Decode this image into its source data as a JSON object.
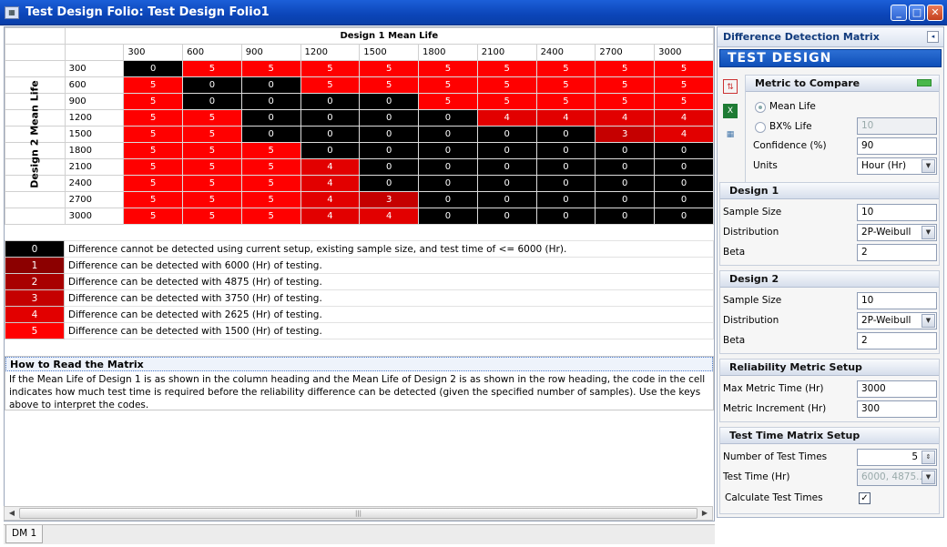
{
  "window": {
    "title": "Test Design Folio: Test Design Folio1",
    "app_icon": "app-icon",
    "buttons": {
      "minimize": "_",
      "maximize": "□",
      "close": "✕"
    }
  },
  "matrix": {
    "title": "Design 1 Mean Life",
    "y_label": "Design 2 Mean Life",
    "columns": [
      "300",
      "600",
      "900",
      "1200",
      "1500",
      "1800",
      "2100",
      "2400",
      "2700",
      "3000"
    ],
    "rows": [
      {
        "label": "300",
        "values": [
          "0",
          "5",
          "5",
          "5",
          "5",
          "5",
          "5",
          "5",
          "5",
          "5"
        ]
      },
      {
        "label": "600",
        "values": [
          "5",
          "0",
          "0",
          "5",
          "5",
          "5",
          "5",
          "5",
          "5",
          "5"
        ]
      },
      {
        "label": "900",
        "values": [
          "5",
          "0",
          "0",
          "0",
          "0",
          "5",
          "5",
          "5",
          "5",
          "5"
        ]
      },
      {
        "label": "1200",
        "values": [
          "5",
          "5",
          "0",
          "0",
          "0",
          "0",
          "4",
          "4",
          "4",
          "4"
        ]
      },
      {
        "label": "1500",
        "values": [
          "5",
          "5",
          "0",
          "0",
          "0",
          "0",
          "0",
          "0",
          "3",
          "4"
        ]
      },
      {
        "label": "1800",
        "values": [
          "5",
          "5",
          "5",
          "0",
          "0",
          "0",
          "0",
          "0",
          "0",
          "0"
        ]
      },
      {
        "label": "2100",
        "values": [
          "5",
          "5",
          "5",
          "4",
          "0",
          "0",
          "0",
          "0",
          "0",
          "0"
        ]
      },
      {
        "label": "2400",
        "values": [
          "5",
          "5",
          "5",
          "4",
          "0",
          "0",
          "0",
          "0",
          "0",
          "0"
        ]
      },
      {
        "label": "2700",
        "values": [
          "5",
          "5",
          "5",
          "4",
          "3",
          "0",
          "0",
          "0",
          "0",
          "0"
        ]
      },
      {
        "label": "3000",
        "values": [
          "5",
          "5",
          "5",
          "4",
          "4",
          "0",
          "0",
          "0",
          "0",
          "0"
        ]
      }
    ]
  },
  "code_colors": {
    "0": "#000000",
    "1": "#8c0000",
    "2": "#a80000",
    "3": "#c50000",
    "4": "#e20000",
    "5": "#ff0000"
  },
  "legend": [
    {
      "code": "0",
      "text": "Difference cannot be detected using current setup, existing sample size, and test time of <= 6000 (Hr)."
    },
    {
      "code": "1",
      "text": "Difference can be detected with 6000 (Hr) of testing."
    },
    {
      "code": "2",
      "text": "Difference can be detected with 4875 (Hr) of testing."
    },
    {
      "code": "3",
      "text": "Difference can be detected with 3750 (Hr) of testing."
    },
    {
      "code": "4",
      "text": "Difference can be detected with 2625 (Hr) of testing."
    },
    {
      "code": "5",
      "text": "Difference can be detected with 1500 (Hr) of testing."
    }
  ],
  "howto": {
    "title": "How to Read the Matrix",
    "body": "If the Mean Life of Design 1 is as shown in the column heading and the Mean Life of Design 2 is as shown in the row heading, the code in the cell indicates how much test time is required before the reliability difference can be detected (given the specified number of samples). Use the keys above to interpret the codes."
  },
  "scrollbar": {
    "left_arrow": "◀",
    "right_arrow": "▶",
    "grip": "|||"
  },
  "tabs": [
    "DM 1"
  ],
  "panel": {
    "title": "Difference Detection Matrix",
    "pin": "◂",
    "banner": "TEST DESIGN",
    "icons": [
      "transfer-icon",
      "excel-icon",
      "grid-icon"
    ],
    "metric": {
      "title": "Metric to Compare",
      "mean_life": "Mean Life",
      "bx_life": "BX% Life",
      "bx_value": "10",
      "confidence_label": "Confidence (%)",
      "confidence": "90",
      "units_label": "Units",
      "units": "Hour (Hr)"
    },
    "design1": {
      "title": "Design 1",
      "sample_size_label": "Sample Size",
      "sample_size": "10",
      "distribution_label": "Distribution",
      "distribution": "2P-Weibull",
      "beta_label": "Beta",
      "beta": "2"
    },
    "design2": {
      "title": "Design 2",
      "sample_size_label": "Sample Size",
      "sample_size": "10",
      "distribution_label": "Distribution",
      "distribution": "2P-Weibull",
      "beta_label": "Beta",
      "beta": "2"
    },
    "reliability": {
      "title": "Reliability Metric Setup",
      "max_label": "Max Metric Time (Hr)",
      "max": "3000",
      "inc_label": "Metric Increment (Hr)",
      "inc": "300"
    },
    "testtime": {
      "title": "Test Time Matrix Setup",
      "num_label": "Number of Test Times",
      "num": "5",
      "tt_label": "Test Time  (Hr)",
      "tt": "6000, 4875...",
      "calc_label": "Calculate Test Times",
      "calc_check": "✓"
    }
  }
}
